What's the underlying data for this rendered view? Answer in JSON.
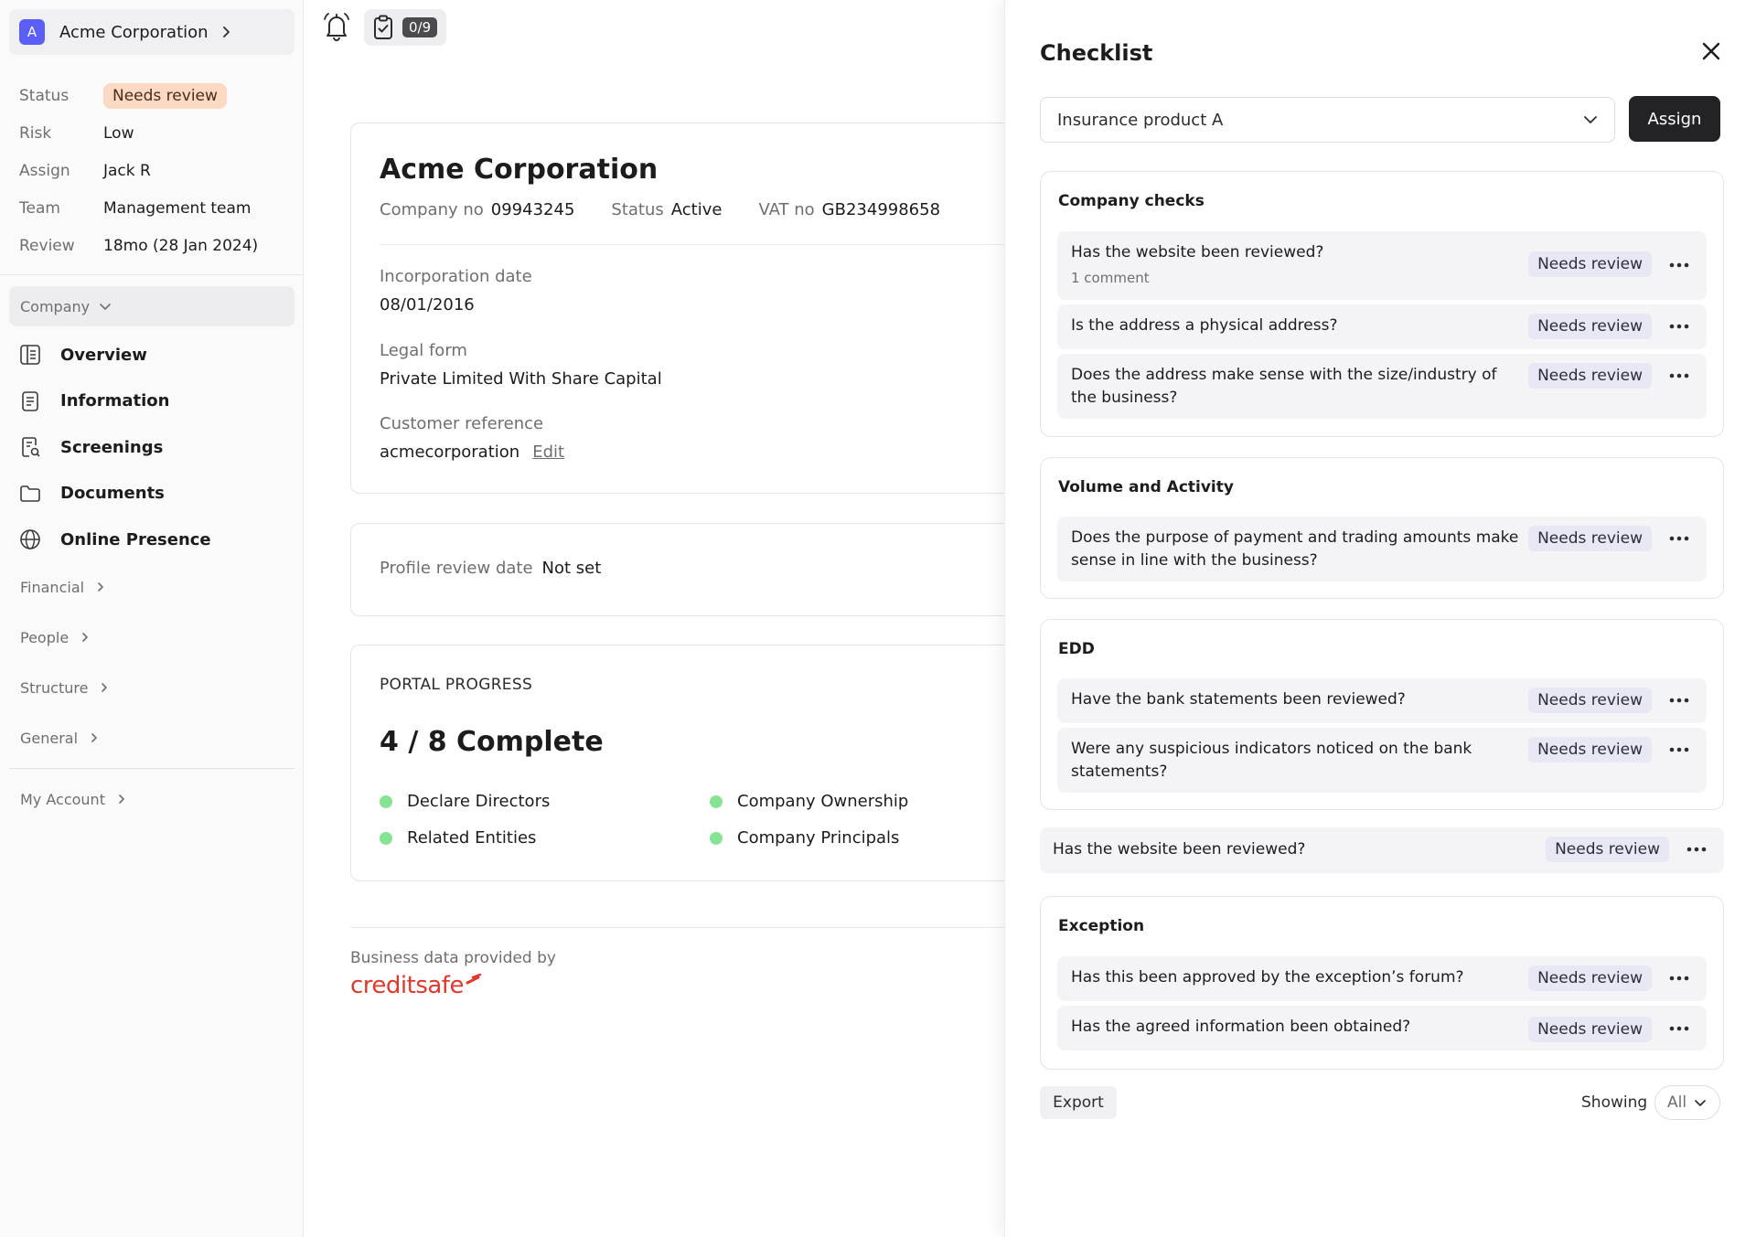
{
  "org": {
    "avatar_letter": "A",
    "name": "Acme Corporation"
  },
  "meta": [
    {
      "key": "Status",
      "value": "Needs review",
      "style": "pill"
    },
    {
      "key": "Risk",
      "value": "Low"
    },
    {
      "key": "Assign",
      "value": "Jack R"
    },
    {
      "key": "Team",
      "value": "Management team"
    },
    {
      "key": "Review",
      "value": "18mo (28 Jan 2024)"
    }
  ],
  "sidebar": {
    "group_label": "Company",
    "nav": [
      {
        "label": "Overview",
        "icon": "overview-icon"
      },
      {
        "label": "Information",
        "icon": "document-icon"
      },
      {
        "label": "Screenings",
        "icon": "screening-search-icon"
      },
      {
        "label": "Documents",
        "icon": "folder-icon"
      },
      {
        "label": "Online Presence",
        "icon": "globe-icon"
      }
    ],
    "sections": [
      "Financial",
      "People",
      "Structure",
      "General"
    ],
    "account": "My Account"
  },
  "toolbar": {
    "checklist_count": "0/9",
    "bell_icon": "bell-icon",
    "checklist_icon": "clipboard-check-icon"
  },
  "company": {
    "title": "Acme Corporation",
    "company_no_label": "Company no",
    "company_no": "09943245",
    "status_label": "Status",
    "status": "Active",
    "vat_label": "VAT no",
    "vat": "GB234998658",
    "incorporation_label": "Incorporation date",
    "incorporation_date": "08/01/2016",
    "legal_form_label": "Legal form",
    "legal_form": "Private Limited With Share Capital",
    "customer_ref_label": "Customer reference",
    "customer_ref": "acmecorporation",
    "edit_label": "Edit"
  },
  "profile_review": {
    "label": "Profile review date",
    "value": "Not set"
  },
  "portal": {
    "heading": "PORTAL PROGRESS",
    "summary": "4 / 8 Complete",
    "items": [
      "Declare Directors",
      "Company Ownership",
      "Related Entities",
      "Company Principals"
    ],
    "dot_color": "#86e394"
  },
  "footer": {
    "provided_by": "Business data provided by",
    "brand": "creditsafe",
    "brand_color": "#e0392b"
  },
  "checklist": {
    "title": "Checklist",
    "product": "Insurance product A",
    "assign_label": "Assign",
    "groups": [
      {
        "title": "Company checks",
        "items": [
          {
            "text": "Has the website been reviewed?",
            "sub": "1 comment",
            "status": "Needs review"
          },
          {
            "text": "Is the address a physical address?",
            "status": "Needs review"
          },
          {
            "text": "Does the address make sense with the size/industry of the business?",
            "status": "Needs review"
          }
        ]
      },
      {
        "title": "Volume and Activity",
        "items": [
          {
            "text": "Does the purpose of payment and trading amounts make sense in line with the business?",
            "status": "Needs review"
          }
        ]
      },
      {
        "title": "EDD",
        "items": [
          {
            "text": "Have the bank statements been reviewed?",
            "status": "Needs review"
          },
          {
            "text": "Were any suspicious indicators noticed on the bank statements?",
            "status": "Needs review"
          }
        ]
      },
      {
        "title": "Exception",
        "items": [
          {
            "text": "Has this been approved by the exception’s forum?",
            "status": "Needs review"
          },
          {
            "text": "Has the agreed information been obtained?",
            "status": "Needs review"
          }
        ]
      }
    ],
    "loose_item": {
      "text": "Has the website been reviewed?",
      "status": "Needs review"
    },
    "export_label": "Export",
    "showing_label": "Showing",
    "showing_value": "All"
  }
}
